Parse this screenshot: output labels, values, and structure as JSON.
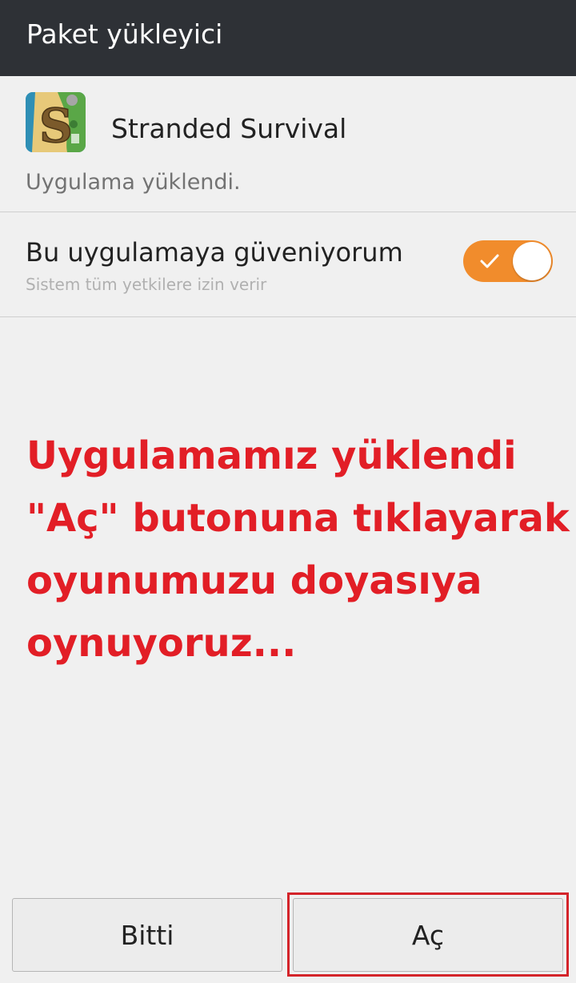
{
  "header": {
    "title": "Paket yükleyici"
  },
  "app": {
    "name": "Stranded Survival",
    "icon": "stranded-survival-app-icon"
  },
  "status_text": "Uygulama yüklendi.",
  "trust": {
    "label": "Bu uygulamaya güveniyorum",
    "sublabel": "Sistem tüm yetkilere izin verir",
    "enabled": true,
    "accent_color": "#f18c2c"
  },
  "annotation": {
    "text": "Uygulamamız yüklendi\n\"Aç\" butonuna tıklayarak\noyunumuzu doyasıya\noynuyoruz...",
    "color": "#e21e26"
  },
  "buttons": {
    "done": "Bitti",
    "open": "Aç"
  },
  "highlight_color": "#d4242a"
}
